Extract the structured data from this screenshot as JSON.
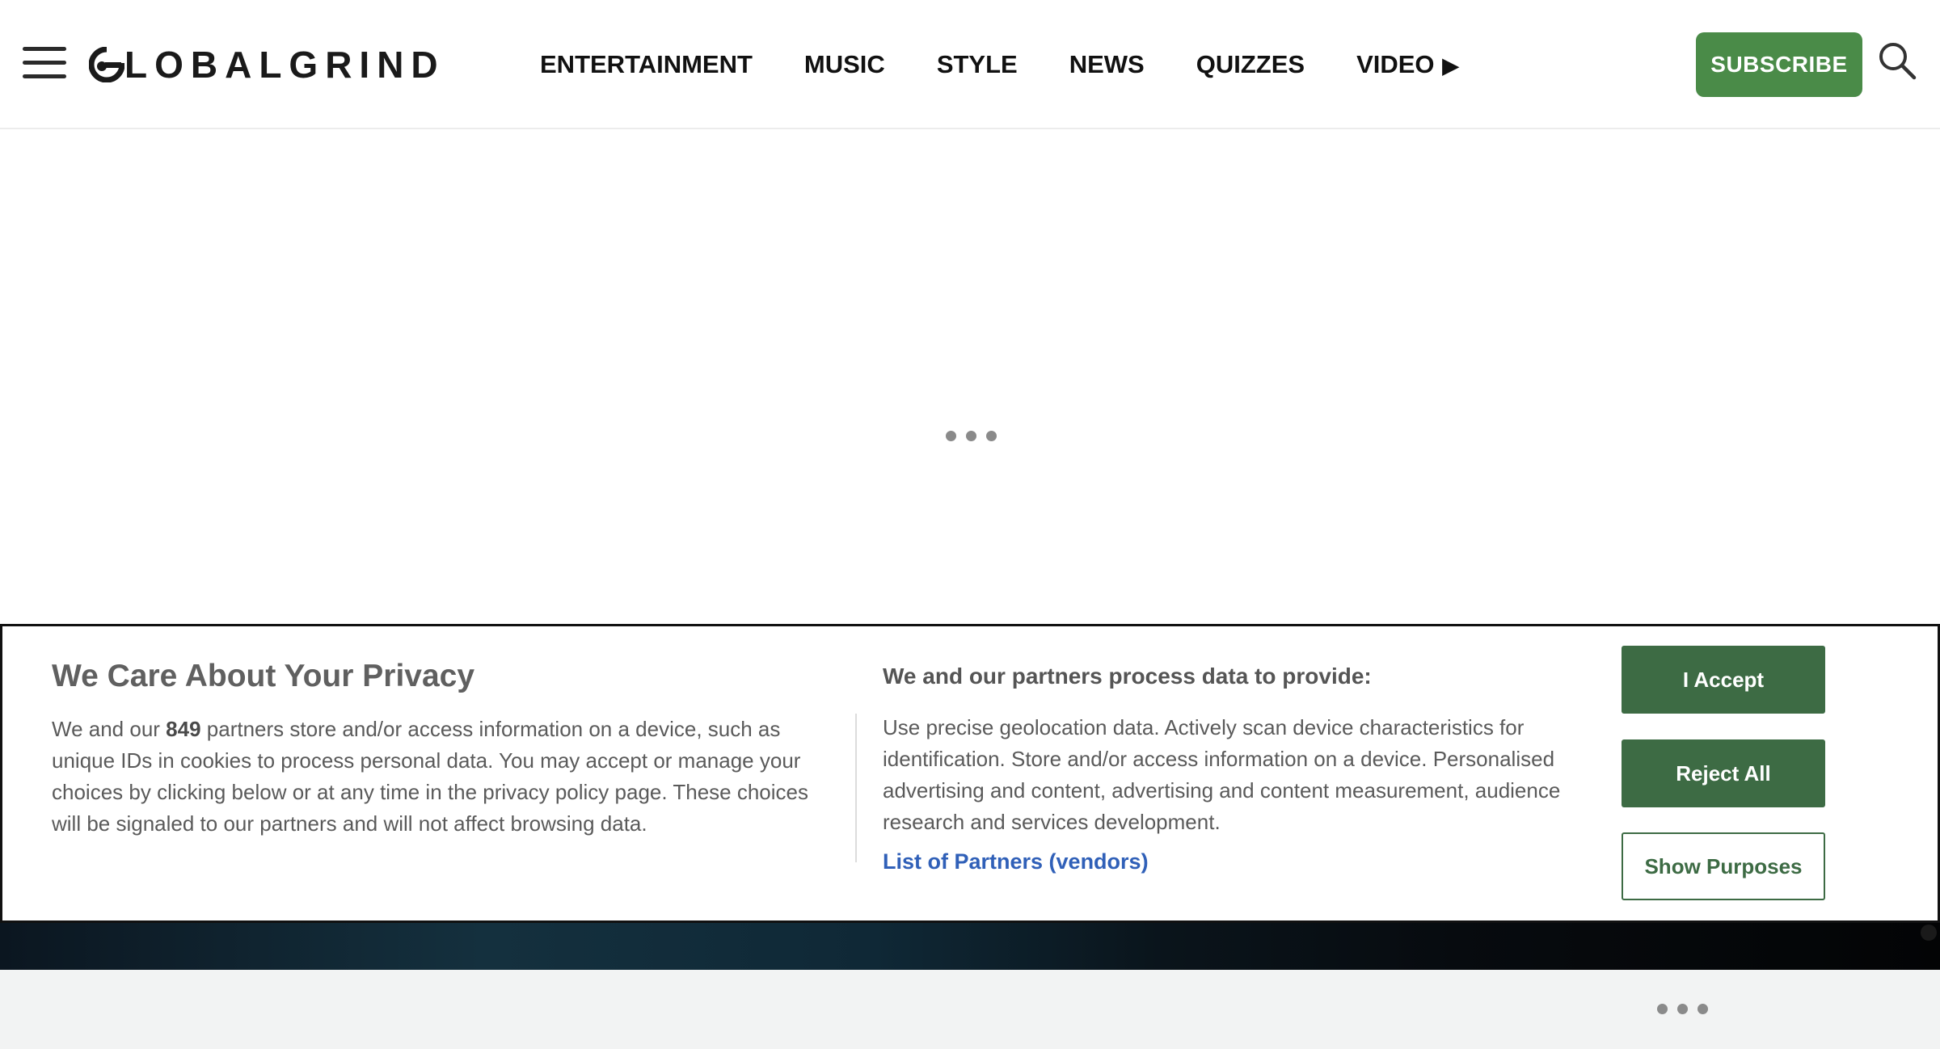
{
  "header": {
    "logo_text": "LOBALGRIND",
    "nav": [
      {
        "label": "ENTERTAINMENT"
      },
      {
        "label": "MUSIC"
      },
      {
        "label": "STYLE"
      },
      {
        "label": "NEWS"
      },
      {
        "label": "QUIZZES"
      },
      {
        "label": "VIDEO",
        "arrow": "▶"
      }
    ],
    "subscribe_label": "SUBSCRIBE",
    "icons": [
      "hamburger-menu-icon",
      "search-icon"
    ]
  },
  "loading_indicator": "• • •",
  "privacy": {
    "title": "We Care About Your Privacy",
    "intro_before": "We and our ",
    "partner_count": "849",
    "intro_after": " partners store and/or access information on a device, such as unique IDs in cookies to process personal data. You may accept or manage your choices by clicking below or at any time in the privacy policy page. These choices will be signaled to our partners and will not affect browsing data.",
    "purpose_heading": "We and our partners process data to provide:",
    "purpose_text": "Use precise geolocation data. Actively scan device characteristics for identification. Store and/or access information on a device. Personalised advertising and content, advertising and content measurement, audience research and services development.",
    "partners_link": "List of Partners (vendors)",
    "accept_label": "I Accept",
    "reject_label": "Reject All",
    "purposes_label": "Show Purposes"
  },
  "colors": {
    "brand_green": "#4a8b48",
    "consent_green": "#3d6b44",
    "link_blue": "#3060b8"
  }
}
